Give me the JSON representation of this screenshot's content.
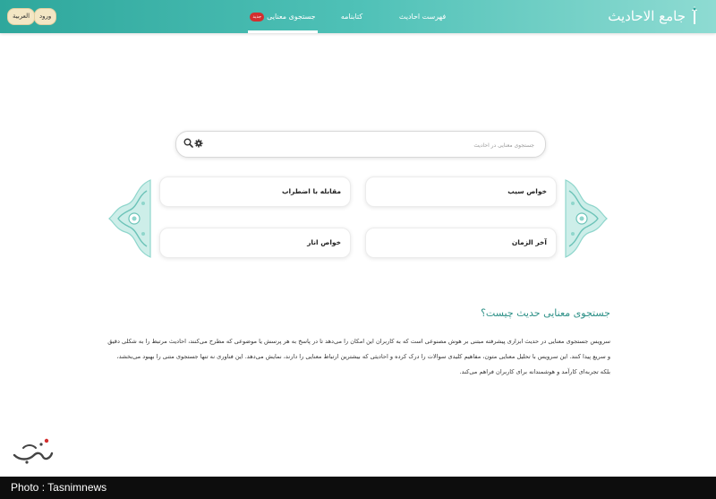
{
  "header": {
    "logo_text": "جامع الاحادیث",
    "nav": [
      {
        "label": "جستجوی معنایی",
        "badge": "جدید",
        "active": true
      },
      {
        "label": "کتابنامه",
        "active": false
      },
      {
        "label": "فهرست احادیث",
        "active": false
      }
    ],
    "login_label": "ورود",
    "language_label": "العربیة"
  },
  "search": {
    "placeholder": "جستجوی معنایی در احادیث",
    "value": ""
  },
  "suggestions": [
    {
      "label": "خواص سیب"
    },
    {
      "label": "مقابله با اضطراب"
    },
    {
      "label": "آخر الزمان"
    },
    {
      "label": "خواص انار"
    }
  ],
  "about": {
    "title": "جستجوی معنایی حدیث چیست؟",
    "body": "سرویس جستجوی معنایی در حدیث ابزاری پیشرفته مبتنی بر هوش مصنوعی است که به کاربران این امکان را می‌دهد تا در پاسخ به هر پرسش یا موضوعی که مطرح می‌کنند، احادیث مرتبط را به شکلی دقیق و سریع پیدا کنند. این سرویس با تحلیل معنایی متون، مفاهیم کلیدی سوالات را درک کرده و احادیثی که بیشترین ارتباط معنایی را دارند، نمایش می‌دهد. این فناوری نه تنها جستجوی متنی را بهبود می‌بخشد، بلکه تجربه‌ای کارآمد و هوشمندانه برای کاربران فراهم می‌کند."
  },
  "watermark": {
    "text": "تسنیم"
  },
  "photo_credit": "Photo : Tasnimnews",
  "colors": {
    "header_teal": "#2ea79c",
    "accent_teal": "#2b8f86",
    "ornament_teal": "#8fd6cc",
    "badge_red": "#d32f2f",
    "button_cream": "#f3e6c4"
  }
}
